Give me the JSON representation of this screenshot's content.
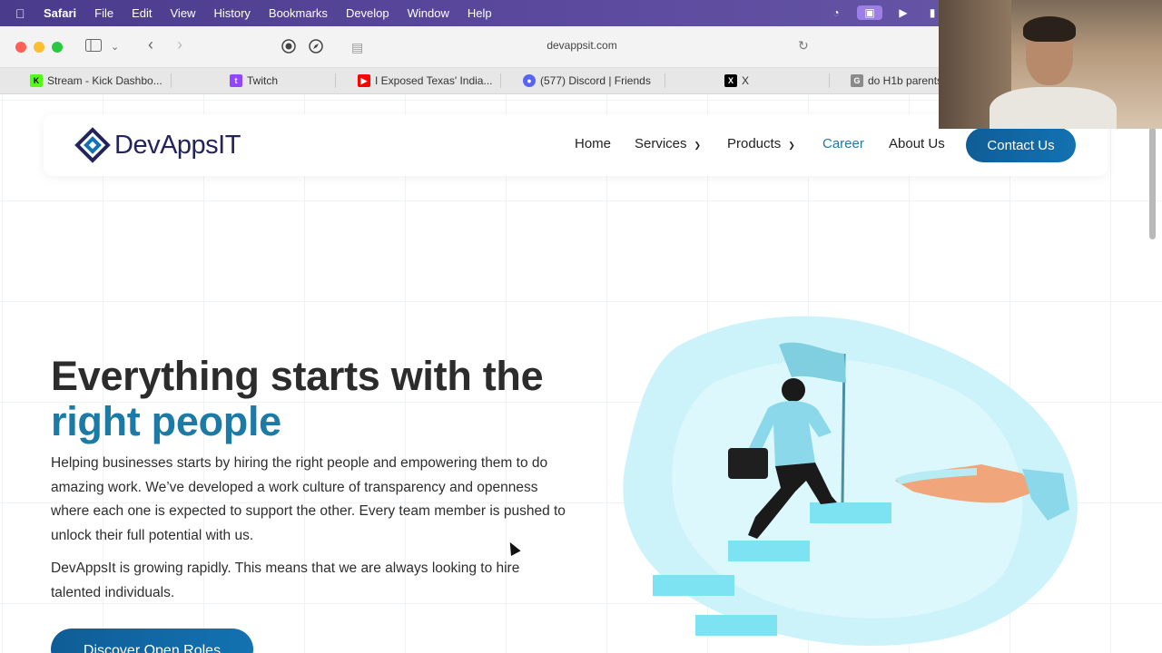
{
  "menubar": {
    "app": "Safari",
    "items": [
      "File",
      "Edit",
      "View",
      "History",
      "Bookmarks",
      "Develop",
      "Window",
      "Help"
    ]
  },
  "toolbar": {
    "url": "devappsit.com"
  },
  "tabs": [
    {
      "label": "Stream - Kick Dashbo...",
      "icon": "kick-icon",
      "color": "#53fc18"
    },
    {
      "label": "Twitch",
      "icon": "twitch-icon",
      "color": "#9146ff"
    },
    {
      "label": "I Exposed Texas' India...",
      "icon": "youtube-icon",
      "color": "#ff0000"
    },
    {
      "label": "(577) Discord | Friends",
      "icon": "discord-icon",
      "color": "#5865f2"
    },
    {
      "label": "X",
      "icon": "x-icon",
      "color": "#000000"
    },
    {
      "label": "do H1b parents",
      "icon": "google-icon",
      "color": "#8a8a8a"
    }
  ],
  "site": {
    "logo_text": "DevAppsIT",
    "nav": {
      "home": "Home",
      "services": "Services",
      "products": "Products",
      "career": "Career",
      "about": "About Us",
      "contact": "Contact Us"
    },
    "hero": {
      "headline_line1": "Everything starts with the",
      "headline_line2": "right people",
      "para1": "Helping businesses starts by hiring the right people and empowering them to do amazing work. We’ve developed a work culture of transparency and openness where each one is expected to support the other. Every team member is pushed to unlock their full potential with us.",
      "para2": "DevAppsIt is growing rapidly. This means that we are always looking to hire talented individuals.",
      "cta": "Discover Open Roles"
    },
    "colors": {
      "brand": "#1372b2",
      "accent_text": "#1b7aa6",
      "navy": "#23255a",
      "illustration": "#7de3f2"
    }
  }
}
